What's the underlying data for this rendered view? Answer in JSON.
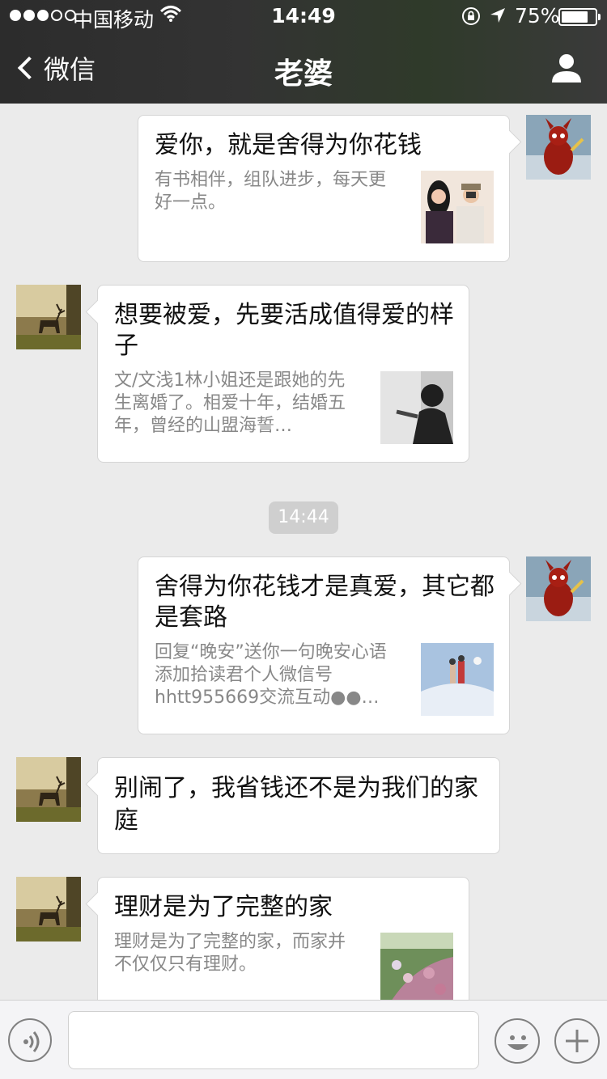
{
  "status_bar": {
    "carrier": "中国移动",
    "time": "14:49",
    "battery_percent": "75%",
    "battery_level": 0.75,
    "signal_strength": 3
  },
  "nav": {
    "back_label": "微信",
    "title": "老婆",
    "profile_icon": "person-icon"
  },
  "messages": [
    {
      "side": "right",
      "type": "card",
      "title": "爱你，就是舍得为你花钱",
      "desc": "有书相伴，组队进步，每天更好一点。"
    },
    {
      "side": "left",
      "type": "card",
      "title": "想要被爱，先要活成值得爱的样子",
      "desc": "文/文浅1林小姐还是跟她的先生离婚了。相爱十年，结婚五年，曾经的山盟海誓…"
    },
    {
      "type": "timestamp",
      "text": "14:44"
    },
    {
      "side": "right",
      "type": "card",
      "title": "舍得为你花钱才是真爱，其它都是套路",
      "desc": "回复“晚安”送你一句晚安心语添加拾读君个人微信号hhtt955669交流互动●●…"
    },
    {
      "side": "left",
      "type": "text",
      "text": "别闹了，我省钱还不是为我们的家庭"
    },
    {
      "side": "left",
      "type": "card",
      "title": "理财是为了完整的家",
      "desc": "理财是为了完整的家，而家并不仅仅只有理财。"
    }
  ],
  "input_bar": {
    "voice_icon": "voice-icon",
    "emoji_icon": "emoji-icon",
    "plus_icon": "plus-icon",
    "input_value": ""
  }
}
